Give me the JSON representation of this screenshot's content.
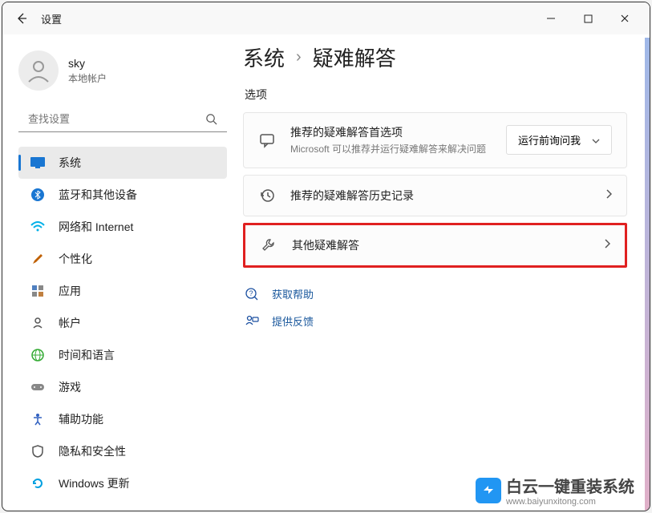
{
  "titlebar": {
    "title": "设置"
  },
  "user": {
    "name": "sky",
    "subtitle": "本地帐户"
  },
  "search": {
    "placeholder": "查找设置"
  },
  "nav": {
    "items": [
      {
        "label": "系统",
        "icon": "system",
        "color": "#1976d2",
        "active": true
      },
      {
        "label": "蓝牙和其他设备",
        "icon": "bluetooth",
        "color": "#1976d2"
      },
      {
        "label": "网络和 Internet",
        "icon": "wifi",
        "color": "#00b0e8"
      },
      {
        "label": "个性化",
        "icon": "personalization",
        "color": "#c06000"
      },
      {
        "label": "应用",
        "icon": "apps",
        "color": "#555"
      },
      {
        "label": "帐户",
        "icon": "accounts",
        "color": "#555"
      },
      {
        "label": "时间和语言",
        "icon": "time",
        "color": "#555"
      },
      {
        "label": "游戏",
        "icon": "gaming",
        "color": "#888"
      },
      {
        "label": "辅助功能",
        "icon": "accessibility",
        "color": "#3060c0"
      },
      {
        "label": "隐私和安全性",
        "icon": "privacy",
        "color": "#555"
      },
      {
        "label": "Windows 更新",
        "icon": "update",
        "color": "#00a0e0"
      }
    ]
  },
  "breadcrumb": {
    "parent": "系统",
    "current": "疑难解答"
  },
  "section": {
    "options_label": "选项"
  },
  "option1": {
    "title": "推荐的疑难解答首选项",
    "subtitle": "Microsoft 可以推荐并运行疑难解答来解决问题",
    "dropdown_label": "运行前询问我"
  },
  "option2": {
    "title": "推荐的疑难解答历史记录"
  },
  "option3": {
    "title": "其他疑难解答"
  },
  "links": {
    "help": "获取帮助",
    "feedback": "提供反馈"
  },
  "watermark": {
    "brand": "白云一键重装系统",
    "url": "www.baiyunxitong.com"
  }
}
